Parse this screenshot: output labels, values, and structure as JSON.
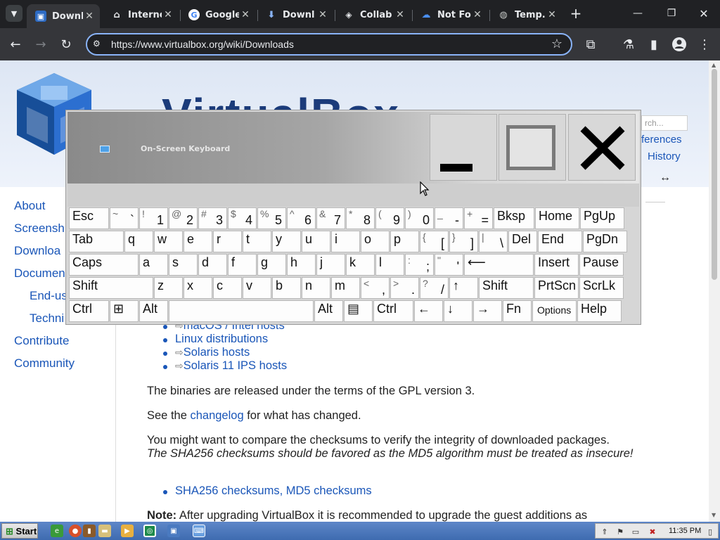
{
  "browser": {
    "tabs": [
      {
        "label": "Downl",
        "icon": "virtualbox-icon",
        "active": true
      },
      {
        "label": "Interne",
        "icon": "archive-icon",
        "active": false
      },
      {
        "label": "Google",
        "icon": "google-icon",
        "active": false
      },
      {
        "label": "Downl",
        "icon": "download-icon",
        "active": false
      },
      {
        "label": "Collab",
        "icon": "collab-icon",
        "active": false
      },
      {
        "label": "Not Fo",
        "icon": "cloud-icon",
        "active": false
      },
      {
        "label": "Temp.s",
        "icon": "globe-icon",
        "active": false
      }
    ],
    "new_tab": "+",
    "url": "https://www.virtualbox.org/wiki/Downloads"
  },
  "page": {
    "title": "VirtualBox",
    "search_placeholder": "rch...",
    "top_links": [
      "ferences",
      "History"
    ],
    "sidebar": [
      "About",
      "Screensh",
      "Downloa",
      "Documen",
      "End-us",
      "Techni",
      "Contribute",
      "Community"
    ],
    "host_links": [
      "macOS / Intel hosts",
      "Linux distributions",
      "Solaris hosts",
      "Solaris 11 IPS hosts"
    ],
    "gpl_text": "The binaries are released under the terms of the GPL version 3.",
    "changelog_pre": "See the ",
    "changelog_link": "changelog",
    "changelog_post": " for what has changed.",
    "checksum_text": "You might want to compare the checksums to verify the integrity of downloaded packages.",
    "checksum_italic": "The SHA256 checksums should be favored as the MD5 algorithm must be treated as insecure!",
    "checksum_link": "SHA256 checksums, MD5 checksums",
    "note_label": "Note:",
    "note_text": " After upgrading VirtualBox it is recommended to upgrade the guest additions as"
  },
  "osk": {
    "title": "On-Screen Keyboard",
    "rows": [
      [
        {
          "t": "main",
          "v": "Esc"
        },
        {
          "t": "dual",
          "s": "~",
          "b": "`"
        },
        {
          "t": "dual",
          "s": "!",
          "b": "1"
        },
        {
          "t": "dual",
          "s": "@",
          "b": "2"
        },
        {
          "t": "dual",
          "s": "#",
          "b": "3"
        },
        {
          "t": "dual",
          "s": "$",
          "b": "4"
        },
        {
          "t": "dual",
          "s": "%",
          "b": "5"
        },
        {
          "t": "dual",
          "s": "^",
          "b": "6"
        },
        {
          "t": "dual",
          "s": "&",
          "b": "7"
        },
        {
          "t": "dual",
          "s": "*",
          "b": "8"
        },
        {
          "t": "dual",
          "s": "(",
          "b": "9"
        },
        {
          "t": "dual",
          "s": ")",
          "b": "0"
        },
        {
          "t": "dual",
          "s": "_",
          "b": "-"
        },
        {
          "t": "dual",
          "s": "+",
          "b": "="
        },
        {
          "t": "main",
          "v": "Bksp"
        },
        {
          "t": "main",
          "v": "Home"
        },
        {
          "t": "main",
          "v": "PgUp"
        }
      ],
      [
        {
          "t": "main",
          "v": "Tab"
        },
        {
          "t": "main",
          "v": "q"
        },
        {
          "t": "main",
          "v": "w"
        },
        {
          "t": "main",
          "v": "e"
        },
        {
          "t": "main",
          "v": "r"
        },
        {
          "t": "main",
          "v": "t"
        },
        {
          "t": "main",
          "v": "y"
        },
        {
          "t": "main",
          "v": "u"
        },
        {
          "t": "main",
          "v": "i"
        },
        {
          "t": "main",
          "v": "o"
        },
        {
          "t": "main",
          "v": "p"
        },
        {
          "t": "dual",
          "s": "{",
          "b": "["
        },
        {
          "t": "dual",
          "s": "}",
          "b": "]"
        },
        {
          "t": "dual",
          "s": "|",
          "b": "\\"
        },
        {
          "t": "main",
          "v": "Del"
        },
        {
          "t": "main",
          "v": "End"
        },
        {
          "t": "main",
          "v": "PgDn"
        }
      ],
      [
        {
          "t": "main",
          "v": "Caps"
        },
        {
          "t": "main",
          "v": "a"
        },
        {
          "t": "main",
          "v": "s"
        },
        {
          "t": "main",
          "v": "d"
        },
        {
          "t": "main",
          "v": "f"
        },
        {
          "t": "main",
          "v": "g"
        },
        {
          "t": "main",
          "v": "h"
        },
        {
          "t": "main",
          "v": "j"
        },
        {
          "t": "main",
          "v": "k"
        },
        {
          "t": "main",
          "v": "l"
        },
        {
          "t": "dual",
          "s": ":",
          "b": ";"
        },
        {
          "t": "dual",
          "s": "\"",
          "b": "'"
        },
        {
          "t": "main",
          "v": "⟵"
        },
        {
          "t": "main",
          "v": "Insert"
        },
        {
          "t": "main",
          "v": "Pause"
        }
      ],
      [
        {
          "t": "main",
          "v": "Shift"
        },
        {
          "t": "main",
          "v": "z"
        },
        {
          "t": "main",
          "v": "x"
        },
        {
          "t": "main",
          "v": "c"
        },
        {
          "t": "main",
          "v": "v"
        },
        {
          "t": "main",
          "v": "b"
        },
        {
          "t": "main",
          "v": "n"
        },
        {
          "t": "main",
          "v": "m"
        },
        {
          "t": "dual",
          "s": "<",
          "b": ","
        },
        {
          "t": "dual",
          "s": ">",
          "b": "."
        },
        {
          "t": "dual",
          "s": "?",
          "b": "/"
        },
        {
          "t": "main",
          "v": "↑"
        },
        {
          "t": "main",
          "v": "Shift"
        },
        {
          "t": "main",
          "v": "PrtScn"
        },
        {
          "t": "main",
          "v": "ScrLk"
        }
      ],
      [
        {
          "t": "main",
          "v": "Ctrl"
        },
        {
          "t": "main",
          "v": "⊞"
        },
        {
          "t": "main",
          "v": "Alt"
        },
        {
          "t": "main",
          "v": ""
        },
        {
          "t": "main",
          "v": "Alt"
        },
        {
          "t": "main",
          "v": "▤"
        },
        {
          "t": "main",
          "v": "Ctrl"
        },
        {
          "t": "main",
          "v": "←"
        },
        {
          "t": "main",
          "v": "↓"
        },
        {
          "t": "main",
          "v": "→"
        },
        {
          "t": "main",
          "v": "Fn"
        },
        {
          "t": "small",
          "v": "Options"
        },
        {
          "t": "main",
          "v": "Help"
        }
      ]
    ]
  },
  "taskbar": {
    "start": "Start",
    "clock": "11:35 PM"
  }
}
